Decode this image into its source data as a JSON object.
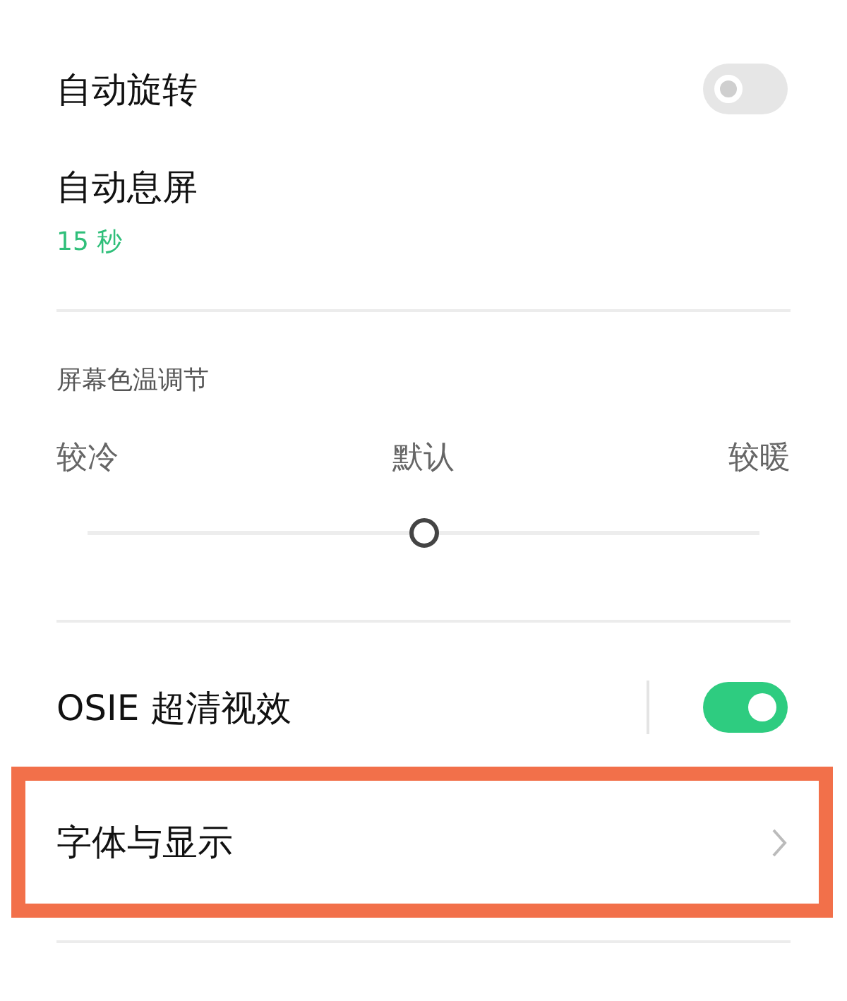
{
  "settings": [
    {
      "kind": "toggle",
      "label": "自动旋转",
      "on": false
    },
    {
      "kind": "value",
      "label": "自动息屏",
      "value": "15 秒"
    },
    {
      "kind": "divider"
    },
    {
      "kind": "slider",
      "title": "屏幕色温调节",
      "min_label": "较冷",
      "mid_label": "默认",
      "max_label": "较暖",
      "level": 0.5
    },
    {
      "kind": "divider"
    },
    {
      "kind": "toggle",
      "label": "OSIE 超清视效",
      "on": true,
      "separator": true
    },
    {
      "kind": "link",
      "label": "字体与显示",
      "highlighted": true
    },
    {
      "kind": "divider"
    }
  ]
}
